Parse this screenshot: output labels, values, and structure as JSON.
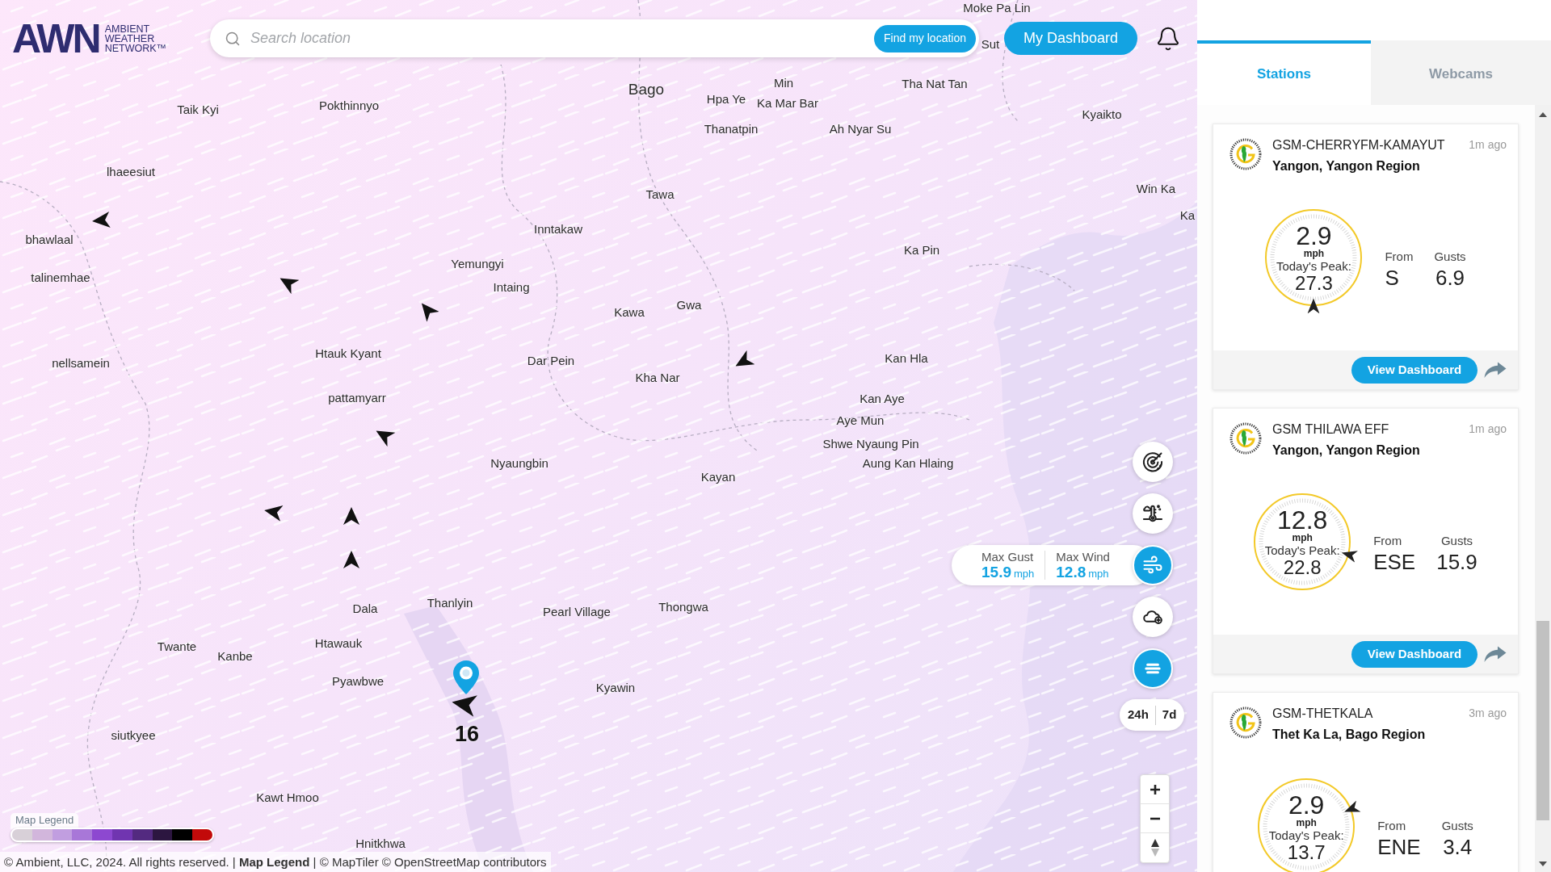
{
  "header": {
    "logo": {
      "mark": "AWN",
      "tagline": [
        "AMBIENT",
        "WEATHER",
        "NETWORK™"
      ]
    },
    "search": {
      "placeholder": "Search location",
      "button": "Find my location"
    },
    "dashboard_button": "My Dashboard"
  },
  "map": {
    "places": [
      {
        "name": "Moke Pa Lin",
        "kind": "town"
      },
      {
        "name": "Sut",
        "kind": "town"
      },
      {
        "name": "Bago",
        "kind": "city"
      },
      {
        "name": "Min",
        "kind": "town"
      },
      {
        "name": "Tha Nat Tan",
        "kind": "town"
      },
      {
        "name": "Taik Kyi",
        "kind": "town"
      },
      {
        "name": "Pokthinnyo",
        "kind": "town"
      },
      {
        "name": "Hpa Ye",
        "kind": "town"
      },
      {
        "name": "Ka Mar Bar",
        "kind": "town"
      },
      {
        "name": "Kyaikto",
        "kind": "town"
      },
      {
        "name": "Thanatpin",
        "kind": "town"
      },
      {
        "name": "Ah Nyar Su",
        "kind": "town"
      },
      {
        "name": "lhaeesiut",
        "kind": "town"
      },
      {
        "name": "Tawa",
        "kind": "town"
      },
      {
        "name": "Win Ka",
        "kind": "town"
      },
      {
        "name": "Ka",
        "kind": "town"
      },
      {
        "name": "bhawlaal",
        "kind": "town"
      },
      {
        "name": "Inntakaw",
        "kind": "town"
      },
      {
        "name": "Ka Pin",
        "kind": "town"
      },
      {
        "name": "Yemungyi",
        "kind": "town"
      },
      {
        "name": "talinemhae",
        "kind": "town"
      },
      {
        "name": "Intaing",
        "kind": "town"
      },
      {
        "name": "Kawa",
        "kind": "town"
      },
      {
        "name": "Gwa",
        "kind": "town"
      },
      {
        "name": "nellsamein",
        "kind": "town"
      },
      {
        "name": "Htauk Kyant",
        "kind": "town"
      },
      {
        "name": "Dar Pein",
        "kind": "town"
      },
      {
        "name": "Kan Hla",
        "kind": "town"
      },
      {
        "name": "Kha Nar",
        "kind": "town"
      },
      {
        "name": "pattamyarr",
        "kind": "town"
      },
      {
        "name": "Kan Aye",
        "kind": "town"
      },
      {
        "name": "Aye Mun",
        "kind": "town"
      },
      {
        "name": "Shwe Nyaung Pin",
        "kind": "town"
      },
      {
        "name": "Nyaungbin",
        "kind": "town"
      },
      {
        "name": "Aung Kan Hlaing",
        "kind": "town"
      },
      {
        "name": "Kayan",
        "kind": "town"
      },
      {
        "name": "Dala",
        "kind": "town"
      },
      {
        "name": "Thanlyin",
        "kind": "town"
      },
      {
        "name": "Pearl Village",
        "kind": "town"
      },
      {
        "name": "Thongwa",
        "kind": "town"
      },
      {
        "name": "Twante",
        "kind": "town"
      },
      {
        "name": "Kanbe",
        "kind": "town"
      },
      {
        "name": "Htawauk",
        "kind": "town"
      },
      {
        "name": "Pyawbwe",
        "kind": "town"
      },
      {
        "name": "Kyawin",
        "kind": "town"
      },
      {
        "name": "siutkyee",
        "kind": "town"
      },
      {
        "name": "Kawt Hmoo",
        "kind": "town"
      },
      {
        "name": "Hnitkhwa",
        "kind": "town"
      }
    ],
    "station_marker": {
      "reading": "16"
    },
    "tools": [
      {
        "kind": "radar",
        "active": false
      },
      {
        "kind": "temperature",
        "active": false
      },
      {
        "kind": "wind",
        "active": true
      },
      {
        "kind": "cloud",
        "active": false
      },
      {
        "kind": "list",
        "active": true
      }
    ],
    "wind_summary": [
      {
        "label": "Max Gust",
        "value": "15.9",
        "unit": "mph"
      },
      {
        "label": "Max Wind",
        "value": "12.8",
        "unit": "mph"
      }
    ],
    "time_range": [
      {
        "label": "24h"
      },
      {
        "label": "7d"
      }
    ],
    "legend": {
      "label": "Map Legend",
      "swatches": [
        {
          "color": "#d8d0d8"
        },
        {
          "color": "#d2b6dc"
        },
        {
          "color": "#c19ee0"
        },
        {
          "color": "#a877d8"
        },
        {
          "color": "#8d48d0"
        },
        {
          "color": "#7035b0"
        },
        {
          "color": "#532a80"
        },
        {
          "color": "#2c1640"
        },
        {
          "color": "#000000"
        },
        {
          "color": "#c20a0a"
        }
      ]
    },
    "attribution": "© Ambient, LLC, 2024. All rights reserved. | **Map Legend** | © MapTiler © OpenStreetMap contributors"
  },
  "panel": {
    "tabs": [
      {
        "label": "Stations",
        "selected": true
      },
      {
        "label": "Webcams",
        "selected": false
      }
    ],
    "stations": [
      {
        "name": "GSM-CHERRYFM-KAMAYUT",
        "location": "Yangon, Yangon Region",
        "age": "1m ago",
        "speed": "2.9",
        "unit": "mph",
        "peak_label": "Today's Peak:",
        "peak": "27.3",
        "from_label": "From",
        "from": "S",
        "gusts_label": "Gusts",
        "gusts": "6.9",
        "button": "View Dashboard"
      },
      {
        "name": "GSM THILAWA EFF",
        "location": "Yangon, Yangon Region",
        "age": "1m ago",
        "speed": "12.8",
        "unit": "mph",
        "peak_label": "Today's Peak:",
        "peak": "22.8",
        "from_label": "From",
        "from": "ESE",
        "gusts_label": "Gusts",
        "gusts": "15.9",
        "button": "View Dashboard"
      },
      {
        "name": "GSM-THETKALA",
        "location": "Thet Ka La, Bago Region",
        "age": "3m ago",
        "speed": "2.9",
        "unit": "mph",
        "peak_label": "Today's Peak:",
        "peak": "13.7",
        "from_label": "From",
        "from": "ENE",
        "gusts_label": "Gusts",
        "gusts": "3.4"
      }
    ]
  }
}
